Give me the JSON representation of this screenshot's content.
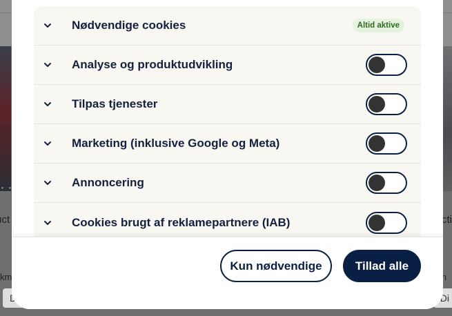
{
  "background": {
    "left_card_title": "uct",
    "right_card_title": "cti",
    "left_spec": "km",
    "right_spec": "n",
    "left_tag": "Dies",
    "right_tag": "Di",
    "dots": "• • • •"
  },
  "consent": {
    "categories": [
      {
        "label": "Nødvendige cookies",
        "badge": "Altid aktive"
      },
      {
        "label": "Analyse og produktudvikling",
        "enabled": false
      },
      {
        "label": "Tilpas tjenester",
        "enabled": false
      },
      {
        "label": "Marketing (inklusive Google og Meta)",
        "enabled": false
      },
      {
        "label": "Annoncering",
        "enabled": false
      },
      {
        "label": "Cookies brugt af reklamepartnere (IAB)",
        "enabled": false
      }
    ],
    "buttons": {
      "necessary_only": "Kun nødvendige",
      "allow_all": "Tillad alle"
    }
  },
  "colors": {
    "primary": "#0a1f44",
    "badge_bg": "#e5f3de",
    "badge_text": "#2e6a1f",
    "row_bg": "#f8f7f2"
  },
  "icons": {
    "row_expand": "chevron-down-icon"
  }
}
